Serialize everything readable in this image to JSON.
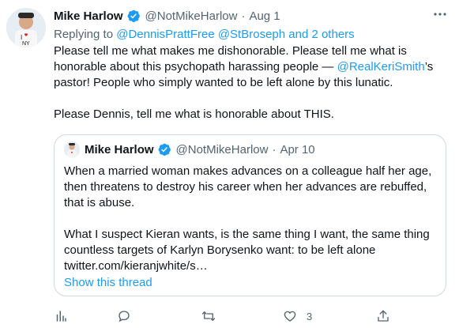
{
  "tweet": {
    "author_name": "Mike Harlow",
    "author_handle": "@NotMikeHarlow",
    "separator": "·",
    "date": "Aug 1",
    "more_icon": "more-dots-icon",
    "replying_prefix": "Replying to ",
    "replying_links": "@DennisPrattFree @StBroseph and 2 others",
    "text": {
      "line1": "Please tell me what makes me dishonorable. Please tell me what is",
      "line2_part1": "honorable about this psychopath harassing people — ",
      "line2_link": "@RealKeriSmith",
      "line2_part2": "’s",
      "line3": "pastor! People who simply wanted to be left alone by this lunatic.",
      "line5": "Please Dennis, tell me what is honorable about THIS."
    }
  },
  "quoted_tweet": {
    "author_name": "Mike Harlow",
    "author_handle": "@NotMikeHarlow",
    "separator": "·",
    "date": "Apr 10",
    "lines": [
      "When a married woman makes advances on a colleague half her age,",
      "then threatens to destroy his career when her advances are rebuffed,",
      "that is abuse.",
      "",
      "What I suspect Kieran wants, is the same thing I want, the same thing",
      "countless targets of Karlyn Borysenko want: to be left alone",
      "twitter.com/kieranjwhite/s…"
    ],
    "show_thread": "Show this thread"
  },
  "actions": {
    "analytics_icon": "analytics-icon",
    "reply_icon": "reply-icon",
    "retweet_icon": "retweet-icon",
    "like_icon": "like-icon",
    "like_count": "3",
    "share_icon": "share-icon"
  },
  "colors": {
    "link": "#1d9bf0",
    "secondary_text": "#536471",
    "border": "#cfd9de"
  }
}
